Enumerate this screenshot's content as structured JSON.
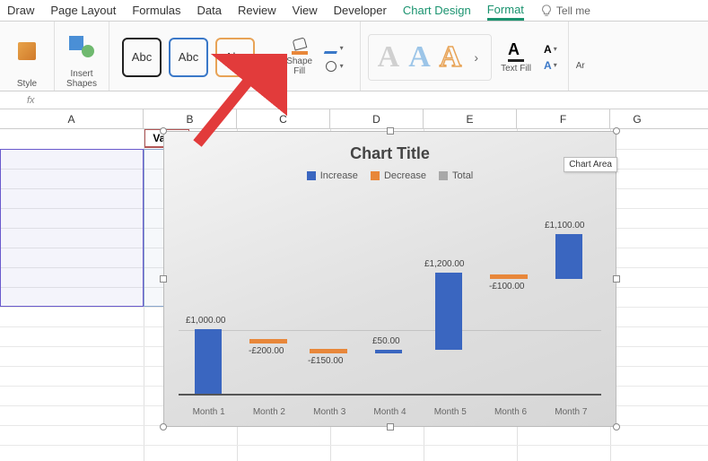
{
  "ribbon": {
    "tabs": [
      "Draw",
      "Page Layout",
      "Formulas",
      "Data",
      "Review",
      "View",
      "Developer"
    ],
    "ctx_tabs": [
      "Chart Design",
      "Format"
    ],
    "tellme": "Tell me",
    "style_label": "Style",
    "insert_shapes": "Insert\nShapes",
    "abc": "Abc",
    "shape_fill": "Shape\nFill",
    "text_fill": "Text Fill",
    "artA": "A",
    "ar_label": "Ar"
  },
  "fbar": {
    "fx": "fx"
  },
  "grid": {
    "cols": [
      "A",
      "B",
      "C",
      "D",
      "E",
      "F",
      "G"
    ],
    "value_hdr": "Value"
  },
  "chart_data": {
    "type": "bar",
    "title": "Chart Title",
    "legend": [
      "Increase",
      "Decrease",
      "Total"
    ],
    "tooltip": "Chart Area",
    "categories": [
      "Month 1",
      "Month 2",
      "Month 3",
      "Month 4",
      "Month 5",
      "Month 6",
      "Month 7"
    ],
    "labels": [
      "£1,000.00",
      "-£200.00",
      "-£150.00",
      "£50.00",
      "£1,200.00",
      "-£100.00",
      "£1,100.00"
    ],
    "values": [
      1000,
      -200,
      -150,
      50,
      1200,
      -100,
      1100
    ],
    "ylim": [
      0,
      2000
    ]
  }
}
